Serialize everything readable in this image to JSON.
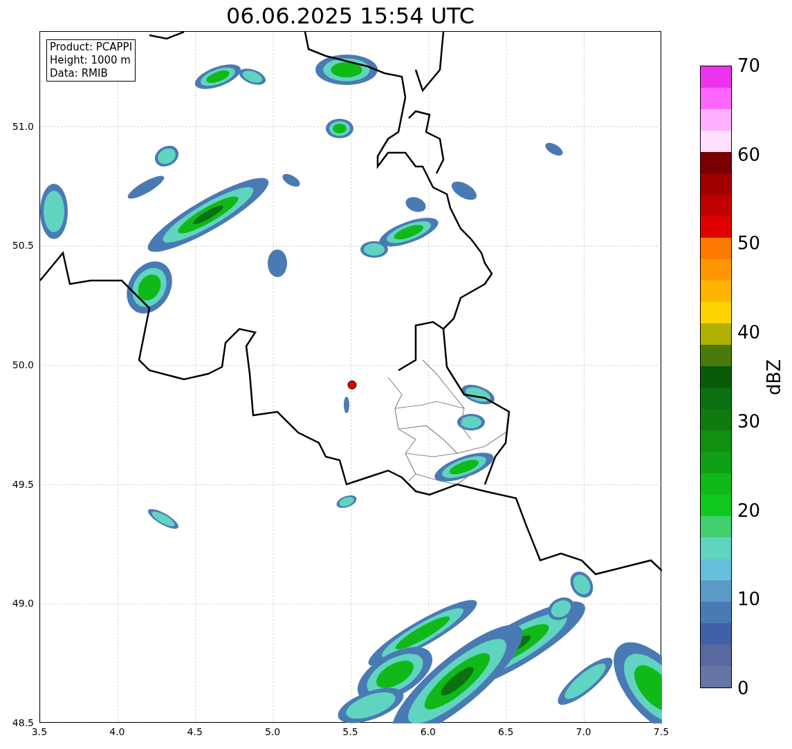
{
  "title": "06.06.2025 15:54 UTC",
  "info_box": [
    "Product: PCAPPI",
    "Height: 1000 m",
    "Data: RMIB"
  ],
  "map": {
    "x_ticks": [
      "3.5",
      "4.0",
      "4.5",
      "5.0",
      "5.5",
      "6.0",
      "6.5",
      "7.0",
      "7.5"
    ],
    "y_ticks": [
      "51.0",
      "50.5",
      "50.0",
      "49.5",
      "49.0",
      "48.5"
    ]
  },
  "colorbar": {
    "label": "dBZ",
    "ticks": [
      "70",
      "60",
      "50",
      "40",
      "30",
      "20",
      "10",
      "0"
    ],
    "bands": [
      {
        "color": "#ee33ee"
      },
      {
        "color": "#ff66ff"
      },
      {
        "color": "#ffb0ff"
      },
      {
        "color": "#ffe0ff"
      },
      {
        "color": "#780000"
      },
      {
        "color": "#a00000"
      },
      {
        "color": "#c00000"
      },
      {
        "color": "#e00000"
      },
      {
        "color": "#ff7a00"
      },
      {
        "color": "#ff9800"
      },
      {
        "color": "#ffb400"
      },
      {
        "color": "#ffd400"
      },
      {
        "color": "#b0b000"
      },
      {
        "color": "#4a7a0a"
      },
      {
        "color": "#085a08"
      },
      {
        "color": "#0a7010"
      },
      {
        "color": "#107a10"
      },
      {
        "color": "#109010"
      },
      {
        "color": "#10a018"
      },
      {
        "color": "#10b818"
      },
      {
        "color": "#10c820"
      },
      {
        "color": "#40d070"
      },
      {
        "color": "#60d4c0"
      },
      {
        "color": "#66c0db"
      },
      {
        "color": "#5a9ac6"
      },
      {
        "color": "#4a7ab4"
      },
      {
        "color": "#4060a8"
      },
      {
        "color": "#5868a0"
      },
      {
        "color": "#6674a6"
      }
    ]
  }
}
